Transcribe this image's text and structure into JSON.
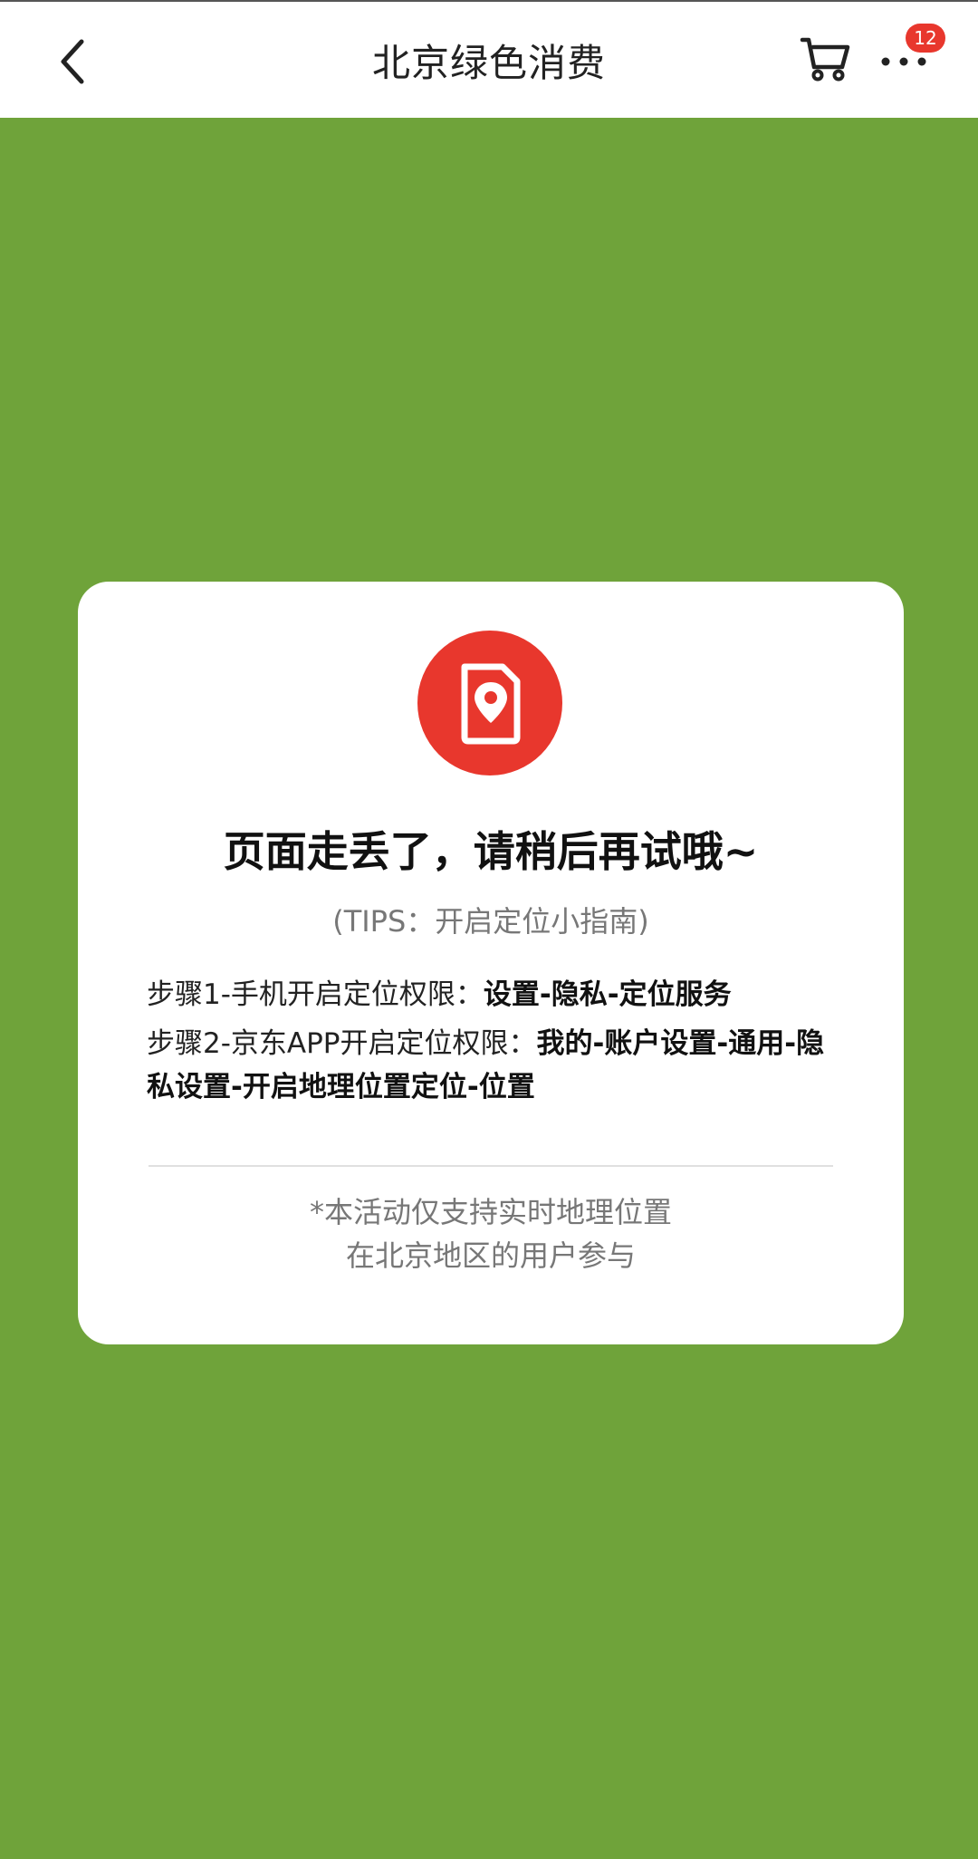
{
  "header": {
    "title": "北京绿色消费",
    "cart_badge": "12"
  },
  "card": {
    "headline": "页面走丢了，请稍后再试哦~",
    "tips": "(TIPS：开启定位小指南)",
    "step1": {
      "prefix": "步骤1-手机开启定位权限：",
      "path": "设置-隐私-定位服务"
    },
    "step2": {
      "prefix": "步骤2-京东APP开启定位权限：",
      "path": "我的-账户设置-通用-隐私设置-开启地理位置定位-位置"
    },
    "note_line1": "*本活动仅支持实时地理位置",
    "note_line2": "在北京地区的用户参与"
  },
  "icons": {
    "back": "chevron-left-icon",
    "cart": "cart-icon",
    "more": "more-dots-icon",
    "location": "location-document-icon"
  },
  "colors": {
    "background": "#6fa33a",
    "accent": "#e8372d"
  }
}
